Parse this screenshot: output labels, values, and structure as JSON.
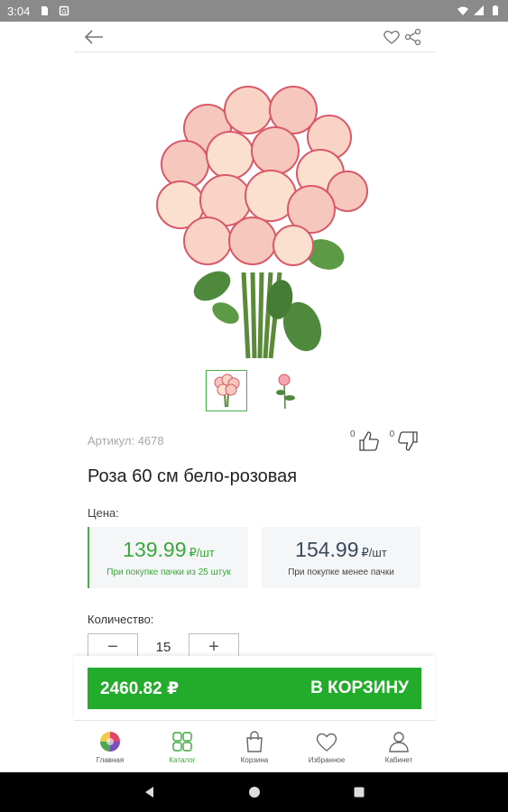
{
  "status_bar": {
    "time": "3:04"
  },
  "product": {
    "sku": "Артикул: 4678",
    "title": "Роза 60 см бело-розовая",
    "likes": "0",
    "dislikes": "0"
  },
  "price": {
    "label": "Цена:",
    "bulk": {
      "value": "139.99",
      "unit": "₽/шт",
      "note": "При покупке пачки из 25 штук"
    },
    "single": {
      "value": "154.99",
      "unit": "₽/шт",
      "note": "При покупке менее пачки"
    }
  },
  "quantity": {
    "label": "Количество:",
    "value": "15",
    "minus": "−",
    "plus": "+"
  },
  "cart": {
    "total": "2460.82 ₽",
    "cta": "В КОРЗИНУ"
  },
  "nav": [
    {
      "label": "Главная",
      "icon": "home-icon"
    },
    {
      "label": "Каталог",
      "icon": "catalog-icon",
      "active": true
    },
    {
      "label": "Корзина",
      "icon": "cart-icon"
    },
    {
      "label": "Избранное",
      "icon": "heart-icon"
    },
    {
      "label": "Кабинет",
      "icon": "user-icon"
    }
  ],
  "colors": {
    "accent": "#23ab2b",
    "price_green": "#3aa83d",
    "status_bar": "#8a8a8a"
  }
}
